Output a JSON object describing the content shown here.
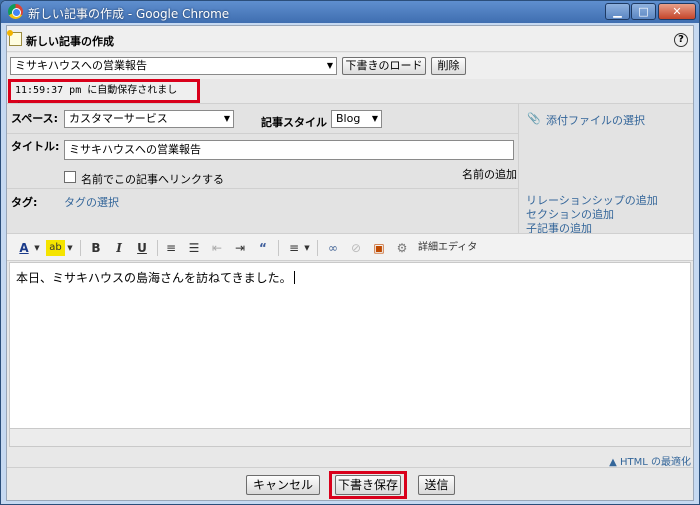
{
  "window": {
    "title": "新しい記事の作成 - Google Chrome",
    "min": "▁",
    "max": "□",
    "close": "✕"
  },
  "dialog": {
    "title": "新しい記事の作成",
    "help": "?",
    "draft_select": "ミサキハウスへの営業報告",
    "load_draft": "下書きのロード",
    "delete": "削除",
    "autosave": "11:59:37 pm に自動保存されました。"
  },
  "form": {
    "space_label": "スペース:",
    "space_value": "カスタマーサービス",
    "style_label": "記事スタイル",
    "style_value": "Blog",
    "attach": "添付ファイルの選択",
    "title_label": "タイトル:",
    "title_value": "ミサキハウスへの営業報告",
    "name_add": "名前の追加",
    "link_by_name": "名前でこの記事へリンクする",
    "tag_label": "タグ:",
    "tag_select": "タグの選択",
    "relationship": "リレーションシップの追加",
    "section": "セクションの追加",
    "child": "子記事の追加"
  },
  "toolbar": {
    "detail_editor": "詳細エディタ"
  },
  "editor": {
    "content": "本日、ミサキハウスの島海さんを訪ねてきました。"
  },
  "footer": {
    "optimize": "▲ HTML の最適化",
    "cancel": "キャンセル",
    "save_draft": "下書き保存",
    "send": "送信"
  },
  "colors": {
    "highlight": "#d9001b",
    "link": "#34669a"
  }
}
